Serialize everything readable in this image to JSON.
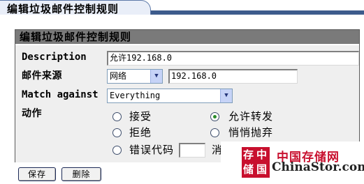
{
  "tab": {
    "title": "编辑垃圾邮件控制规则"
  },
  "panel": {
    "title": "编辑垃圾邮件控制规则"
  },
  "form": {
    "description_label": "Description",
    "description_value": "允许192.168.0",
    "source_label": "邮件来源",
    "source_type_selected": "网络",
    "source_value": "192.168.0",
    "match_label": "Match against",
    "match_selected": "Everything",
    "action_label": "动作",
    "actions": {
      "accept": "接受",
      "allow_forward": "允许转发",
      "reject": "拒绝",
      "silent_drop": "悄悄抛弃",
      "error_code": "错误代码",
      "error_msg_partial": "消"
    },
    "selected_action": "allow_forward"
  },
  "buttons": {
    "save": "保存",
    "delete": "删除"
  },
  "watermark": {
    "seal_chars": [
      "存",
      "中",
      "储",
      "国"
    ],
    "cn_text": "中国存储网",
    "en_text": "ChinaStor.com"
  },
  "colors": {
    "tab_strip": "#3d5b8c",
    "panel_header": "#7a7a7a",
    "panel_body": "#efefef",
    "brand_red": "#c8102e"
  }
}
